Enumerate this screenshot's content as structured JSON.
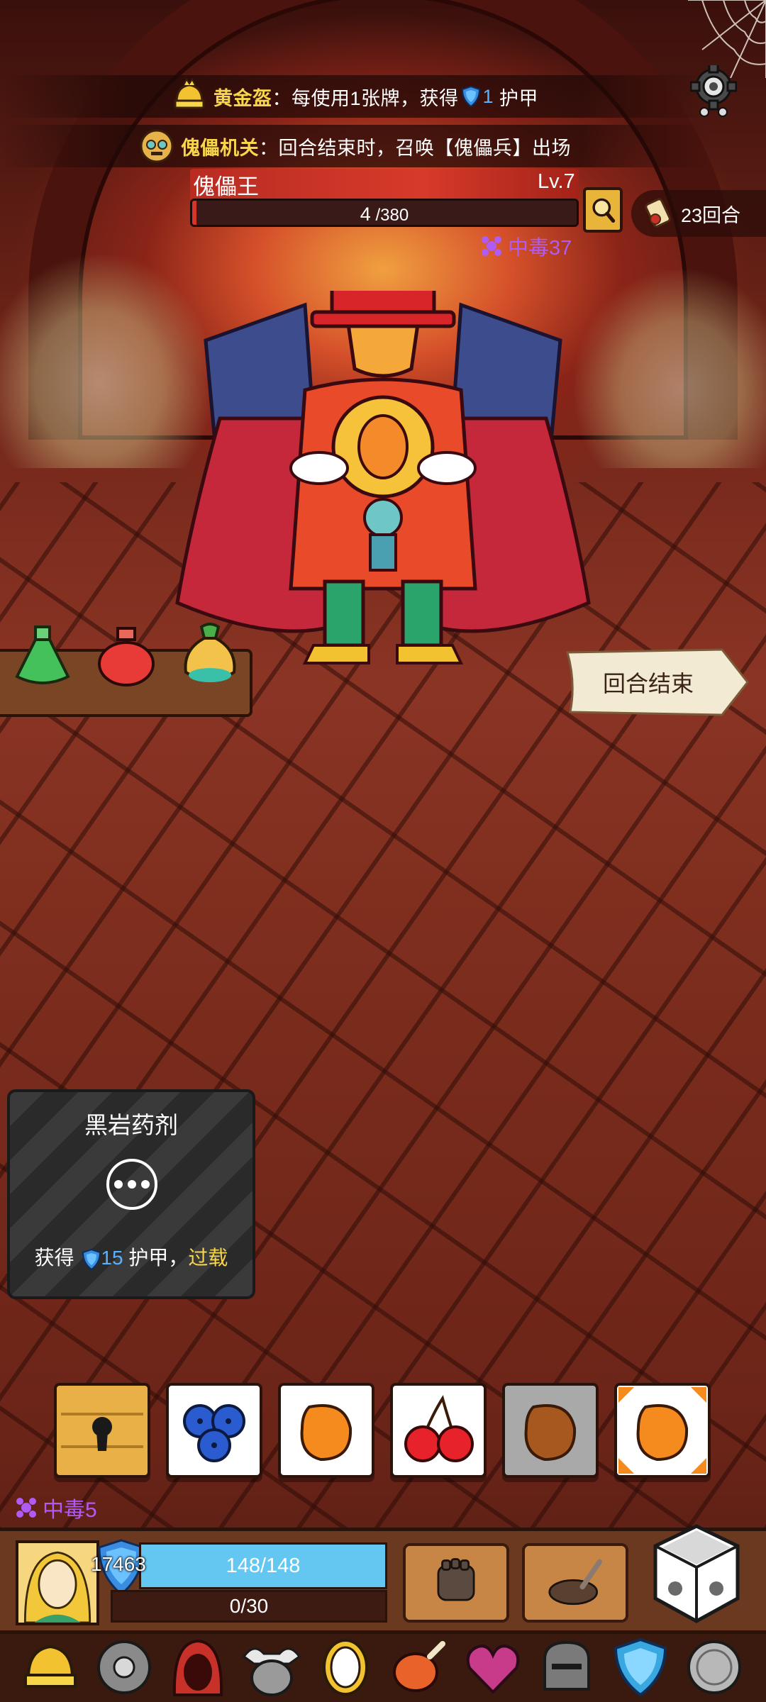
{
  "buffs": [
    {
      "name": "黄金盔",
      "sep": "：",
      "desc_before": "每使用1张牌，获得",
      "value": "1",
      "desc_after": "护甲",
      "icon": "golden-helmet-icon"
    },
    {
      "name": "傀儡机关",
      "sep": "：",
      "desc": "回合结束时，召唤【傀儡兵】出场",
      "icon": "puppet-mechanism-icon"
    }
  ],
  "boss": {
    "name": "傀儡王",
    "level": "Lv.7",
    "hp_current": "4",
    "hp_max": "/380",
    "hp_fraction": 0.0105,
    "poison_label": "中毒37"
  },
  "turns": "23回合",
  "end_turn_label": "回合结束",
  "potions": [
    "green-potion-icon",
    "red-potion-icon",
    "teal-potion-icon"
  ],
  "card_tooltip": {
    "title": "黑岩药剂",
    "desc_prefix": "获得",
    "armor_value": "15",
    "desc_mid": "护甲，",
    "keyword": "过载"
  },
  "dice_slots": [
    "lock-chest-icon",
    "blueberry-icon",
    "mango-icon",
    "cherry-icon",
    "mango-icon",
    "mango-icon"
  ],
  "player": {
    "poison_label": "中毒5",
    "armor": "17463",
    "hp": "148/148",
    "energy": "0/30"
  },
  "skills": [
    "fist-skill-icon",
    "dig-skill-icon"
  ],
  "relics": [
    "golden-helmet-icon",
    "sawblade-icon",
    "red-hood-icon",
    "winged-pot-icon",
    "mirror-icon",
    "meat-icon",
    "heart-icon",
    "iron-helmet-icon",
    "blue-shield-icon",
    "coin-icon"
  ]
}
